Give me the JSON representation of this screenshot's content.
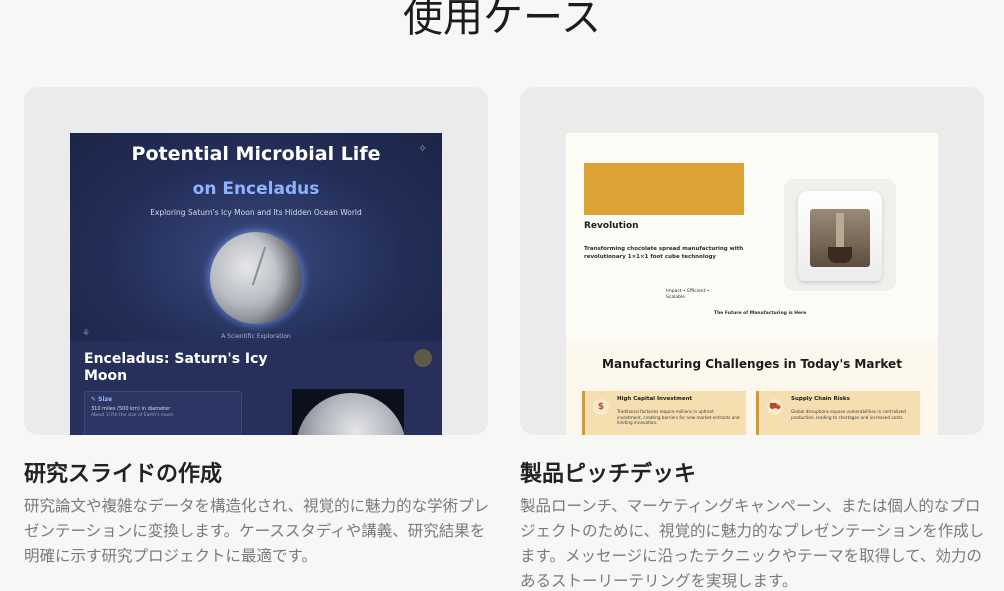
{
  "section": {
    "title": "使用ケース"
  },
  "cards": [
    {
      "title": "研究スライドの作成",
      "description": "研究論文や複雑なデータを構造化され、視覚的に魅力的な学術プレゼンテーションに変換します。ケーススタディや講義、研究結果を明確に示す研究プロジェクトに最適です。",
      "slide": {
        "heading": "Potential Microbial Life",
        "heading2": "on Enceladus",
        "subtitle": "Exploring Saturn's Icy Moon and Its Hidden Ocean World",
        "caption": "A Scientific Exploration",
        "lower_title": "Enceladus: Saturn's Icy Moon",
        "info_label": "Size",
        "info_value": "310 miles (500 km) in diameter",
        "info_note": "About 1/7th the size of Earth's moon"
      }
    },
    {
      "title": "製品ピッチデッキ",
      "description": "製品ローンチ、マーケティングキャンペーン、または個人的なプロジェクトのために、視覚的に魅力的なプレゼンテーションを作成します。メッセージに沿ったテクニックやテーマを取得して、効力のあるストーリーテリングを実現します。",
      "slide": {
        "heading": "Revolution",
        "desc": "Transforming chocolate spread manufacturing with revolutionary 1×1×1 foot cube technology",
        "impact": "Impact • Efficient • Scalable",
        "future": "The Future of Manufacturing is Here",
        "lower_title": "Manufacturing Challenges in Today's Market",
        "box1_title": "High Capital Investment",
        "box1_desc": "Traditional factories require millions in upfront investment, creating barriers for new market entrants and limiting innovation.",
        "box2_title": "Supply Chain Risks",
        "box2_desc": "Global disruptions expose vulnerabilities in centralized production, leading to shortages and increased costs."
      }
    }
  ],
  "icons": {
    "size": "✎",
    "dollar": "$",
    "truck": "⛟",
    "star": "✧",
    "corner": "⚘"
  },
  "colors": {
    "accent_gold": "#dda236",
    "space_bg": "#1c2547",
    "card_bg": "#ebebeb"
  }
}
